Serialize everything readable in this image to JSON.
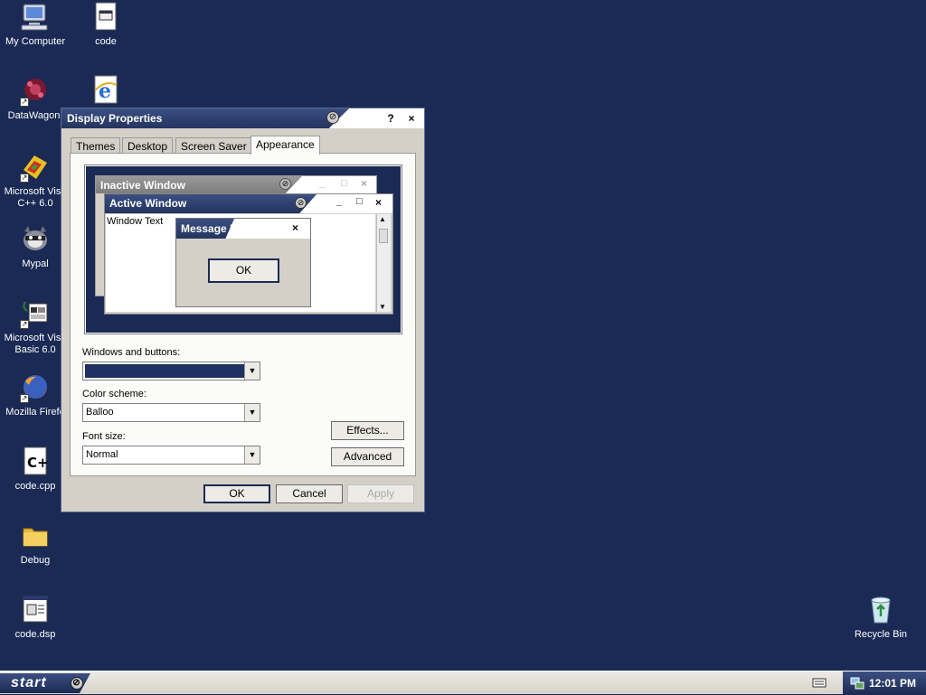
{
  "colors": {
    "desktop": "#1a2a55",
    "title_active": "#2c3e6e",
    "title_inactive": "#8c8c8c",
    "swatch": "#1e3060"
  },
  "desktop_icons": [
    {
      "label": "My Computer",
      "icon": "computer-icon"
    },
    {
      "label": "code",
      "icon": "document-icon"
    },
    {
      "label": "DataWagon.",
      "icon": "datawagon-icon"
    },
    {
      "label": "",
      "icon": "internet-explorer-icon"
    },
    {
      "label": "Microsoft Visu",
      "label2": "C++ 6.0",
      "icon": "visual-cpp-icon"
    },
    {
      "label": "Mypal",
      "icon": "mypal-icon"
    },
    {
      "label": "Microsoft Visu",
      "label2": "Basic 6.0",
      "icon": "visual-basic-icon"
    },
    {
      "label": "Mozilla Firefo",
      "icon": "firefox-icon"
    },
    {
      "label": "code.cpp",
      "icon": "cpp-file-icon"
    },
    {
      "label": "Debug",
      "icon": "folder-icon"
    },
    {
      "label": "code.dsp",
      "icon": "dsp-file-icon"
    },
    {
      "label": "Recycle Bin",
      "icon": "recycle-bin-icon"
    }
  ],
  "window": {
    "title": "Display Properties",
    "help": "?",
    "close": "×",
    "tabs": [
      "Themes",
      "Desktop",
      "Screen Saver",
      "Appearance"
    ],
    "active_tab": "Appearance",
    "preview": {
      "inactive_title": "Inactive Window",
      "active_title": "Active Window",
      "window_text": "Window Text",
      "message_title": "Message B...",
      "ok": "OK",
      "min": "_",
      "max": "□",
      "close": "×"
    },
    "windows_buttons_label": "Windows and buttons:",
    "color_scheme_label": "Color scheme:",
    "color_scheme_value": "Balloo",
    "font_size_label": "Font size:",
    "font_size_value": "Normal",
    "effects_button": "Effects...",
    "advanced_button": "Advanced",
    "ok_button": "OK",
    "cancel_button": "Cancel",
    "apply_button": "Apply"
  },
  "taskbar": {
    "start_label": "start",
    "clock": "12:01 PM"
  }
}
